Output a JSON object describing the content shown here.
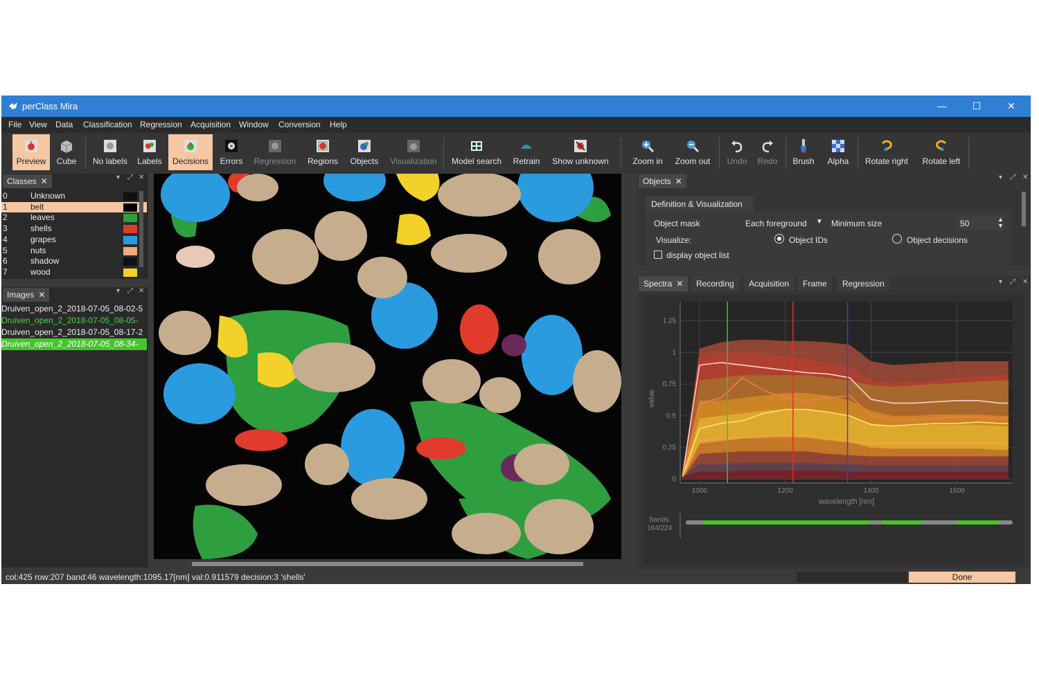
{
  "window": {
    "title": "perClass Mira",
    "minimize": "—",
    "maximize": "☐",
    "close": "✕"
  },
  "menu": [
    "File",
    "View",
    "Data",
    "Classification",
    "Regression",
    "Acquisition",
    "Window",
    "Conversion",
    "Help"
  ],
  "toolbar": [
    {
      "label": "Preview",
      "icon": "preview-icon",
      "state": "active"
    },
    {
      "label": "Cube",
      "icon": "cube-icon",
      "state": "normal"
    },
    {
      "label": "No labels",
      "icon": "no-labels-icon",
      "state": "normal"
    },
    {
      "label": "Labels",
      "icon": "labels-icon",
      "state": "normal"
    },
    {
      "label": "Decisions",
      "icon": "decisions-icon",
      "state": "active"
    },
    {
      "label": "Errors",
      "icon": "errors-icon",
      "state": "normal"
    },
    {
      "label": "Regression",
      "icon": "regression-icon",
      "state": "disabled"
    },
    {
      "label": "Regions",
      "icon": "regions-icon",
      "state": "normal"
    },
    {
      "label": "Objects",
      "icon": "objects-icon",
      "state": "normal"
    },
    {
      "label": "Visualization",
      "icon": "visualization-icon",
      "state": "disabled"
    },
    {
      "label": "Model search",
      "icon": "model-search-icon",
      "state": "normal"
    },
    {
      "label": "Retrain",
      "icon": "retrain-icon",
      "state": "normal"
    },
    {
      "label": "Show unknown",
      "icon": "show-unknown-icon",
      "state": "normal"
    },
    {
      "label": "Zoom in",
      "icon": "zoom-in-icon",
      "state": "normal"
    },
    {
      "label": "Zoom out",
      "icon": "zoom-out-icon",
      "state": "normal"
    },
    {
      "label": "Undo",
      "icon": "undo-icon",
      "state": "disabled"
    },
    {
      "label": "Redo",
      "icon": "redo-icon",
      "state": "disabled"
    },
    {
      "label": "Brush",
      "icon": "brush-icon",
      "state": "normal"
    },
    {
      "label": "Alpha",
      "icon": "alpha-icon",
      "state": "normal"
    },
    {
      "label": "Rotate right",
      "icon": "rotate-right-icon",
      "state": "normal"
    },
    {
      "label": "Rotate left",
      "icon": "rotate-left-icon",
      "state": "normal"
    }
  ],
  "classes_panel": {
    "tab": "Classes",
    "items": [
      {
        "id": "0",
        "name": "Unknown",
        "color": "#111111"
      },
      {
        "id": "1",
        "name": "belt",
        "color": "#000000"
      },
      {
        "id": "2",
        "name": "leaves",
        "color": "#2e9e3e"
      },
      {
        "id": "3",
        "name": "shells",
        "color": "#e03b2c"
      },
      {
        "id": "4",
        "name": "grapes",
        "color": "#2b9be0"
      },
      {
        "id": "5",
        "name": "nuts",
        "color": "#f2a880"
      },
      {
        "id": "6",
        "name": "shadow",
        "color": "#111111"
      },
      {
        "id": "7",
        "name": "wood",
        "color": "#f2d12a"
      }
    ]
  },
  "images_panel": {
    "tab": "Images",
    "items": [
      {
        "name": "Druiven_open_2_2018-07-05_08-02-5",
        "state": "normal"
      },
      {
        "name": "Druiven_open_2_2018-07-05_08-05-",
        "state": "green"
      },
      {
        "name": "Druiven_open_2_2018-07-05_08-17-2",
        "state": "normal"
      },
      {
        "name": "Druiven_open_2_2018-07-05_08-34-",
        "state": "selected"
      }
    ]
  },
  "objects_panel": {
    "tab": "Objects",
    "section": "Definition & Visualization",
    "object_mask_label": "Object mask",
    "object_mask_value": "Each foreground",
    "minimum_size_label": "Minimum  size",
    "minimum_size_value": "50",
    "visualize_label": "Visualize:",
    "radio_ids": "Object IDs",
    "radio_decisions": "Object decisions",
    "checkbox_label": "display object list"
  },
  "spectra_tabs": [
    "Spectra",
    "Recording",
    "Acquisition",
    "Frame",
    "Regression"
  ],
  "chart_data": {
    "type": "area",
    "xlabel": "wavelength [nm]",
    "ylabel": "value",
    "x_ticks": [
      1000,
      1200,
      1400,
      1600
    ],
    "y_ticks": [
      0,
      0.25,
      0.5,
      0.75,
      1,
      1.25
    ],
    "xlim": [
      955,
      1730
    ],
    "ylim": [
      -0.03,
      1.4
    ],
    "x": [
      960,
      1000,
      1050,
      1100,
      1150,
      1200,
      1250,
      1300,
      1350,
      1400,
      1450,
      1500,
      1550,
      1600,
      1650,
      1700,
      1720
    ],
    "bands": [
      {
        "color": "#b4503a",
        "opacity": 0.75,
        "upper": [
          0.02,
          1.03,
          1.08,
          1.1,
          1.1,
          1.09,
          1.09,
          1.08,
          1.06,
          0.93,
          0.9,
          0.91,
          0.92,
          0.93,
          0.93,
          0.93,
          0.93
        ],
        "lower": [
          0.0,
          0.0,
          0.0,
          0.0,
          0.0,
          0.0,
          0.0,
          0.0,
          0.0,
          0.0,
          0.0,
          0.0,
          0.0,
          0.0,
          0.0,
          0.0,
          0.0
        ]
      },
      {
        "color": "#c83a2c",
        "opacity": 0.55,
        "upper": [
          0.02,
          0.98,
          1.0,
          1.0,
          0.99,
          0.97,
          0.95,
          0.92,
          0.88,
          0.78,
          0.76,
          0.77,
          0.78,
          0.8,
          0.81,
          0.82,
          0.82
        ],
        "lower": [
          0.0,
          0.35,
          0.36,
          0.37,
          0.37,
          0.36,
          0.35,
          0.34,
          0.33,
          0.3,
          0.29,
          0.29,
          0.29,
          0.29,
          0.29,
          0.29,
          0.29
        ]
      },
      {
        "color": "#a28a2a",
        "opacity": 0.55,
        "upper": [
          0.02,
          0.78,
          0.8,
          0.82,
          0.82,
          0.82,
          0.82,
          0.8,
          0.78,
          0.74,
          0.73,
          0.74,
          0.75,
          0.76,
          0.77,
          0.78,
          0.78
        ],
        "lower": [
          0.0,
          0.3,
          0.31,
          0.32,
          0.32,
          0.32,
          0.32,
          0.3,
          0.29,
          0.27,
          0.27,
          0.27,
          0.27,
          0.27,
          0.27,
          0.27,
          0.27
        ]
      },
      {
        "color": "#e69a20",
        "opacity": 0.6,
        "upper": [
          0.02,
          0.62,
          0.62,
          0.64,
          0.66,
          0.68,
          0.68,
          0.66,
          0.62,
          0.54,
          0.5,
          0.5,
          0.51,
          0.51,
          0.51,
          0.5,
          0.5
        ],
        "lower": [
          0.0,
          0.2,
          0.21,
          0.22,
          0.22,
          0.22,
          0.22,
          0.2,
          0.19,
          0.18,
          0.18,
          0.18,
          0.18,
          0.18,
          0.18,
          0.18,
          0.18
        ]
      },
      {
        "color": "#e8c232",
        "opacity": 0.6,
        "upper": [
          0.02,
          0.48,
          0.5,
          0.52,
          0.54,
          0.55,
          0.55,
          0.53,
          0.5,
          0.44,
          0.42,
          0.42,
          0.43,
          0.43,
          0.43,
          0.42,
          0.42
        ],
        "lower": [
          0.0,
          0.28,
          0.3,
          0.32,
          0.33,
          0.34,
          0.33,
          0.31,
          0.29,
          0.25,
          0.24,
          0.24,
          0.24,
          0.24,
          0.24,
          0.23,
          0.23
        ]
      },
      {
        "color": "#404060",
        "opacity": 0.6,
        "upper": [
          0.02,
          0.12,
          0.12,
          0.13,
          0.13,
          0.13,
          0.13,
          0.12,
          0.12,
          0.11,
          0.11,
          0.11,
          0.11,
          0.11,
          0.11,
          0.11,
          0.11
        ],
        "lower": [
          0.0,
          0.0,
          0.0,
          0.0,
          0.0,
          0.0,
          0.0,
          0.0,
          0.0,
          0.0,
          0.0,
          0.0,
          0.0,
          0.0,
          0.0,
          0.0,
          0.0
        ]
      },
      {
        "color": "#7a1a1a",
        "opacity": 0.7,
        "upper": [
          0.02,
          0.06,
          0.06,
          0.07,
          0.07,
          0.07,
          0.07,
          0.07,
          0.06,
          0.06,
          0.06,
          0.06,
          0.06,
          0.06,
          0.06,
          0.06,
          0.06
        ],
        "lower": [
          0.0,
          0.0,
          0.0,
          0.0,
          0.0,
          0.0,
          0.0,
          0.0,
          0.0,
          0.0,
          0.0,
          0.0,
          0.0,
          0.0,
          0.0,
          0.0,
          0.0
        ]
      }
    ],
    "lines": [
      {
        "color": "#ffd0c8",
        "y": [
          0.02,
          0.9,
          0.92,
          0.9,
          0.88,
          0.86,
          0.84,
          0.83,
          0.8,
          0.63,
          0.6,
          0.6,
          0.61,
          0.62,
          0.62,
          0.6,
          0.6
        ]
      },
      {
        "color": "#f07a55",
        "y": [
          0.02,
          0.6,
          0.64,
          0.8,
          0.7,
          0.64,
          0.62,
          0.64,
          0.66,
          0.5,
          0.46,
          0.47,
          0.48,
          0.49,
          0.49,
          0.48,
          0.48
        ]
      },
      {
        "color": "#ffe070",
        "y": [
          0.02,
          0.4,
          0.44,
          0.46,
          0.52,
          0.55,
          0.55,
          0.53,
          0.5,
          0.43,
          0.42,
          0.43,
          0.44,
          0.44,
          0.45,
          0.44,
          0.44
        ]
      },
      {
        "color": "#ff9a5a",
        "y": [
          0.02,
          0.3,
          0.32,
          0.33,
          0.34,
          0.34,
          0.34,
          0.32,
          0.3,
          0.28,
          0.28,
          0.28,
          0.28,
          0.28,
          0.28,
          0.28,
          0.28
        ]
      }
    ],
    "markers": [
      {
        "x": 1065,
        "color": "#3cbf3c"
      },
      {
        "x": 1218,
        "color": "#e0302a"
      },
      {
        "x": 1345,
        "color": "#3a40c8"
      }
    ],
    "bands_label": "bands:",
    "bands_count": "164/224"
  },
  "status": {
    "text": "col:425 row:207 band:46 wavelength:1095.17[nm] val:0.911579 decision:3 'shells'",
    "done": "Done"
  }
}
